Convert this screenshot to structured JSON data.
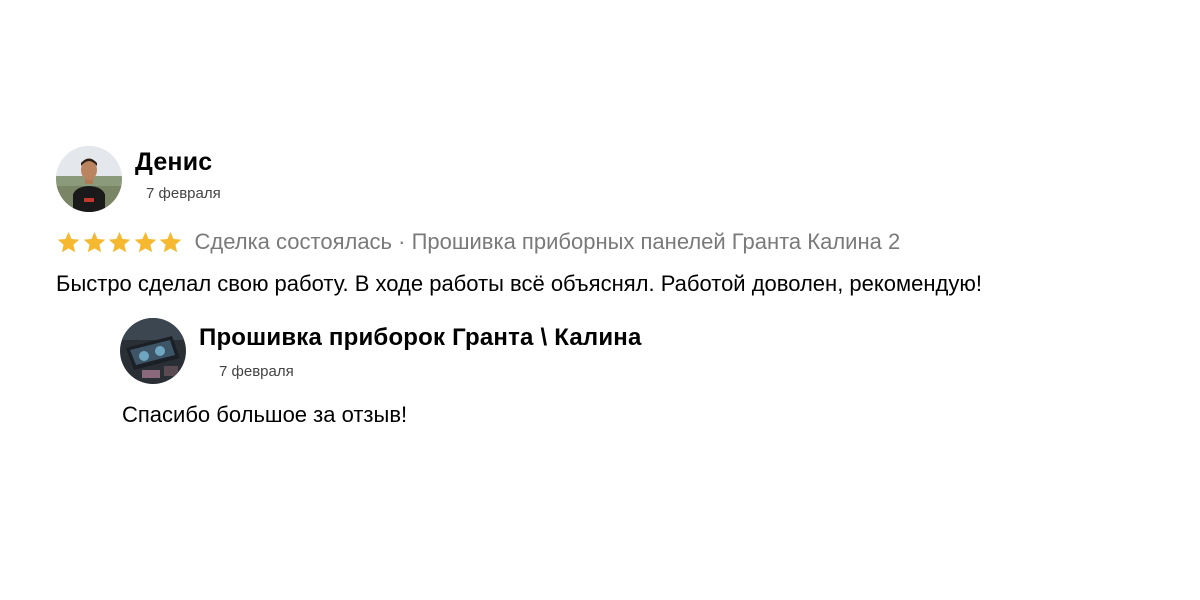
{
  "review": {
    "author": "Денис",
    "date": "7 февраля",
    "rating": 5,
    "rating_max": 5,
    "star_color": "#F5B82E",
    "deal_status": "Сделка состоялась · Прошивка приборных панелей Гранта Калина 2",
    "text": "Быстро сделал свою работу. В ходе работы всё объяснял. Работой доволен, рекомендую!",
    "avatar_icon": "user-photo-avatar"
  },
  "reply": {
    "author": "Прошивка приборок Гранта \\ Калина",
    "date": "7 февраля",
    "text": "Спасибо большое за отзыв!",
    "avatar_icon": "seller-photo-avatar"
  }
}
